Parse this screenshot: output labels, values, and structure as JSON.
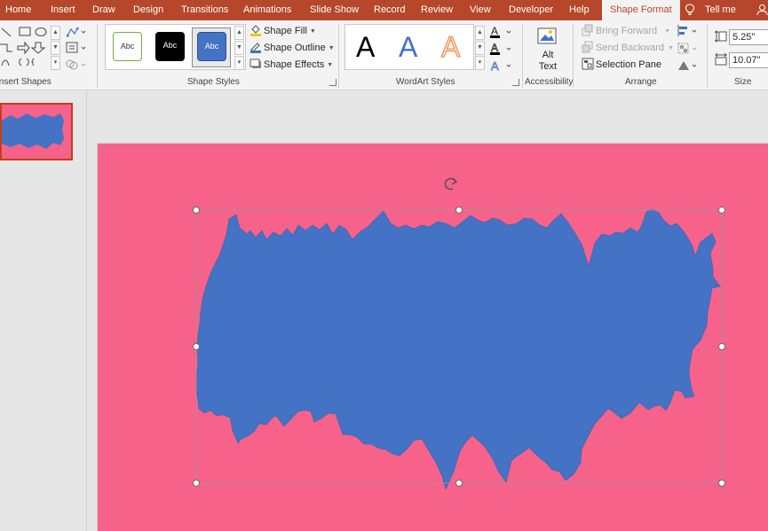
{
  "tabs": {
    "home": "Home",
    "insert": "Insert",
    "draw": "Draw",
    "design": "Design",
    "transitions": "Transitions",
    "animations": "Animations",
    "slideshow": "Slide Show",
    "record": "Record",
    "review": "Review",
    "view": "View",
    "developer": "Developer",
    "help": "Help",
    "shape_format": "Shape Format",
    "tell_me": "Tell me"
  },
  "ribbon": {
    "insert_shapes": {
      "label": "Insert Shapes"
    },
    "shape_styles": {
      "label": "Shape Styles",
      "swatches": [
        "Abc",
        "Abc",
        "Abc"
      ],
      "fill": "Shape Fill",
      "outline": "Shape Outline",
      "effects": "Shape Effects"
    },
    "wordart": {
      "label": "WordArt Styles",
      "letters": [
        "A",
        "A",
        "A"
      ]
    },
    "accessibility": {
      "label": "Accessibility",
      "alt_text_line1": "Alt",
      "alt_text_line2": "Text"
    },
    "arrange": {
      "label": "Arrange",
      "bring_forward": "Bring Forward",
      "send_backward": "Send Backward",
      "selection_pane": "Selection Pane"
    },
    "size": {
      "label": "Size",
      "height": "5.25\"",
      "width": "10.07\""
    }
  },
  "colors": {
    "accent": "#b7472a",
    "slide_bg": "#f6628a",
    "shape_fill": "#4472c4",
    "thumb_border": "#c43e1c"
  },
  "icons": [
    "shape-gallery-icon",
    "edit-shape-icon",
    "text-box-icon",
    "merge-shapes-icon",
    "shape-fill-icon",
    "shape-outline-icon",
    "shape-effects-icon",
    "text-fill-icon",
    "text-outline-icon",
    "text-effects-icon",
    "alt-text-icon",
    "selection-pane-icon",
    "align-icon",
    "group-icon",
    "rotate-icon",
    "height-icon",
    "width-icon",
    "lightbulb-icon",
    "user-icon",
    "rotation-handle-icon"
  ]
}
